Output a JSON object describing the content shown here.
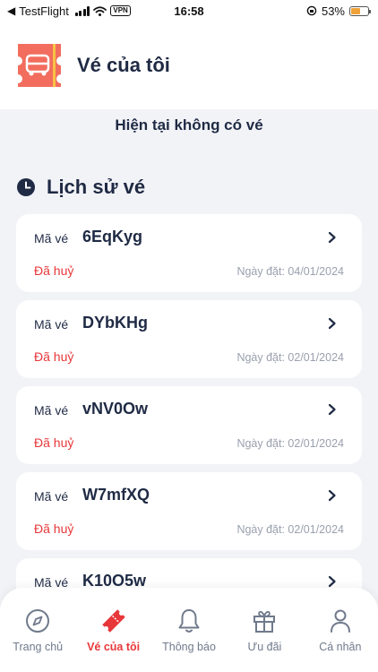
{
  "status_bar": {
    "back_app": "TestFlight",
    "vpn": "VPN",
    "time": "16:58",
    "battery_percent": "53%",
    "battery_level": 0.53
  },
  "header": {
    "title": "Vé của tôi",
    "icon": "bus-ticket-icon"
  },
  "empty_state": "Hiện tại không có vé",
  "history": {
    "title": "Lịch sử vé",
    "items": [
      {
        "label": "Mã vé",
        "code": "6EqKyg",
        "status": "Đã huỷ",
        "date": "Ngày đặt: 04/01/2024"
      },
      {
        "label": "Mã vé",
        "code": "DYbKHg",
        "status": "Đã huỷ",
        "date": "Ngày đặt: 02/01/2024"
      },
      {
        "label": "Mã vé",
        "code": "vNV0Ow",
        "status": "Đã huỷ",
        "date": "Ngày đặt: 02/01/2024"
      },
      {
        "label": "Mã vé",
        "code": "W7mfXQ",
        "status": "Đã huỷ",
        "date": "Ngày đặt: 02/01/2024"
      },
      {
        "label": "Mã vé",
        "code": "K10O5w"
      }
    ]
  },
  "nav": {
    "items": [
      {
        "label": "Trang chủ",
        "icon": "compass-icon"
      },
      {
        "label": "Vé của tôi",
        "icon": "ticket-icon",
        "active": true
      },
      {
        "label": "Thông báo",
        "icon": "bell-icon"
      },
      {
        "label": "Ưu đãi",
        "icon": "gift-icon"
      },
      {
        "label": "Cá nhân",
        "icon": "user-icon"
      }
    ]
  },
  "colors": {
    "accent": "#e8373a",
    "text": "#1f2a44",
    "muted": "#9aa0ae",
    "background": "#f2f3f7"
  }
}
